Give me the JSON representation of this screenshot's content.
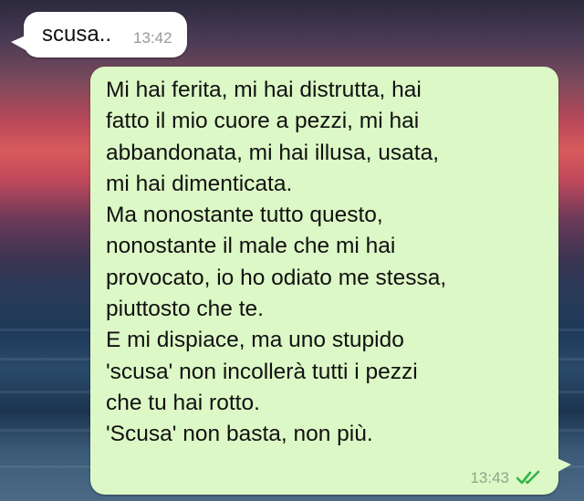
{
  "messages": {
    "incoming": {
      "text": "scusa..",
      "time": "13:42"
    },
    "outgoing": {
      "lines": [
        "Mi hai ferita, mi hai distrutta, hai",
        "fatto il mio cuore a pezzi, mi hai",
        "abbandonata, mi hai illusa, usata,",
        "mi hai dimenticata.",
        "Ma nonostante tutto questo,",
        "nonostante il male che mi hai",
        "provocato, io ho odiato me stessa,",
        "piuttosto che te.",
        "E mi dispiace, ma uno stupido",
        "'scusa' non incollerà tutti i pezzi",
        "che tu hai rotto.",
        "'Scusa' non basta, non più."
      ],
      "time": "13:43",
      "status_icon": "double-check-icon"
    }
  },
  "colors": {
    "incoming_bubble": "#ffffff",
    "outgoing_bubble": "#dcf8c6",
    "read_ticks": "#34b34a"
  }
}
